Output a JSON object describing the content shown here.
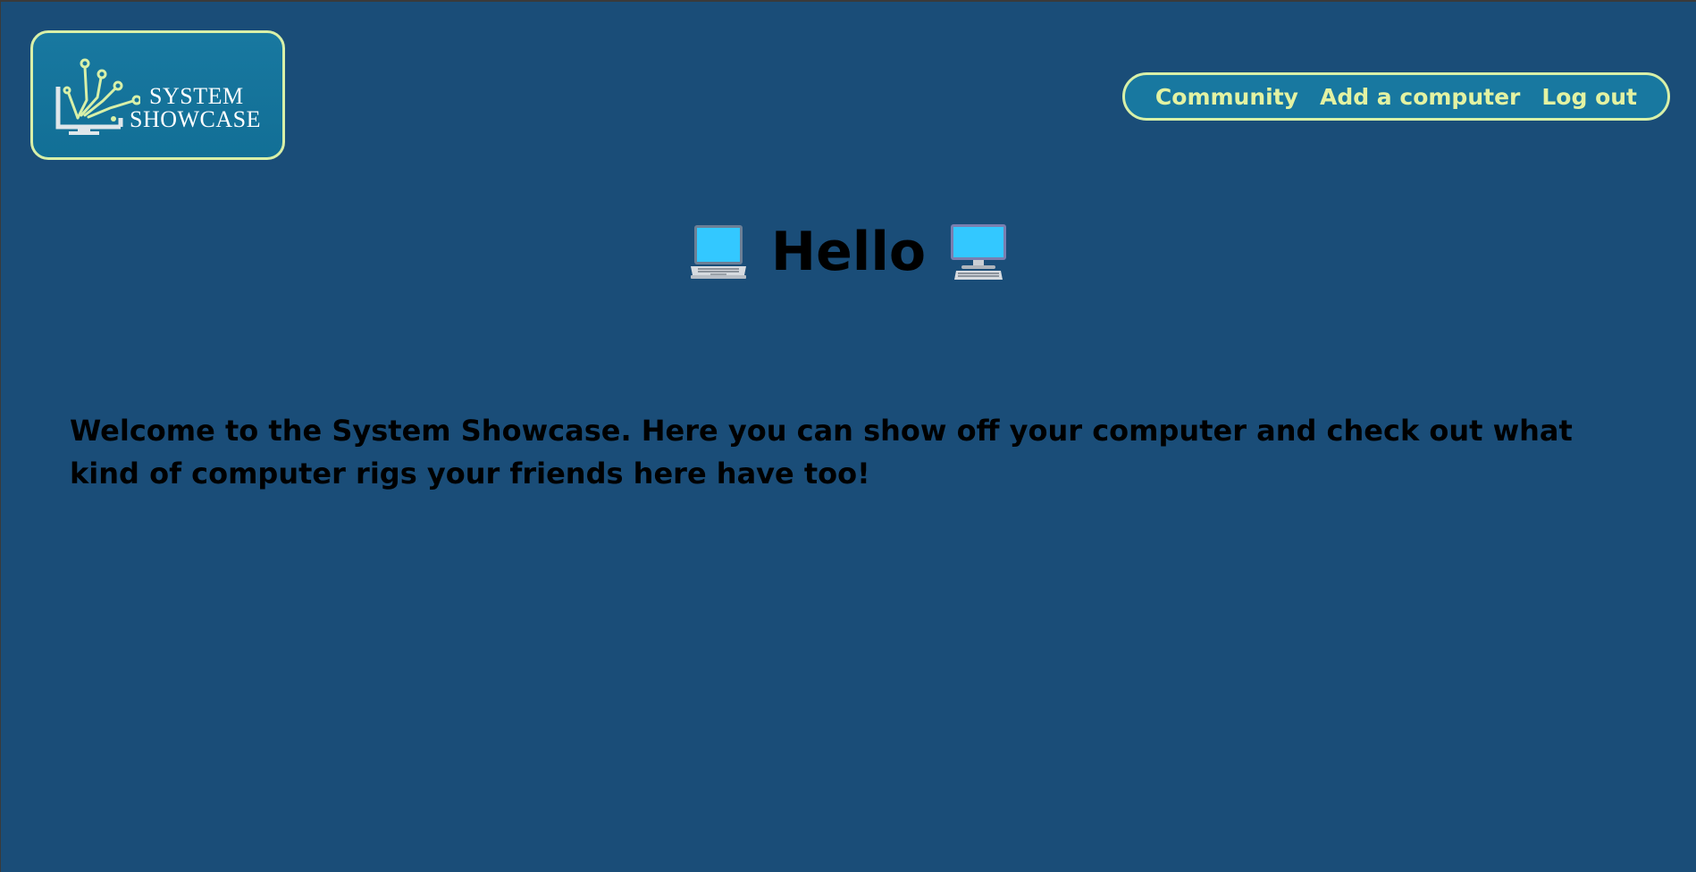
{
  "logo": {
    "line1": "SYSTEM",
    "line2": "SHOWCASE",
    "icon": "computer-circuit-logo-icon"
  },
  "nav": {
    "items": [
      {
        "label": "Community"
      },
      {
        "label": "Add a computer"
      },
      {
        "label": "Log out"
      }
    ]
  },
  "main": {
    "greeting": "Hello",
    "left_icon": "laptop-icon",
    "right_icon": "desktop-computer-icon",
    "welcome_text": "Welcome to the System Showcase. Here you can show off your computer and check out what kind of computer rigs your friends here have too!"
  },
  "colors": {
    "background": "#1a4d78",
    "panel": "#1878a0",
    "accent_border": "#d8f0a8",
    "nav_text": "#e3f2a2"
  }
}
